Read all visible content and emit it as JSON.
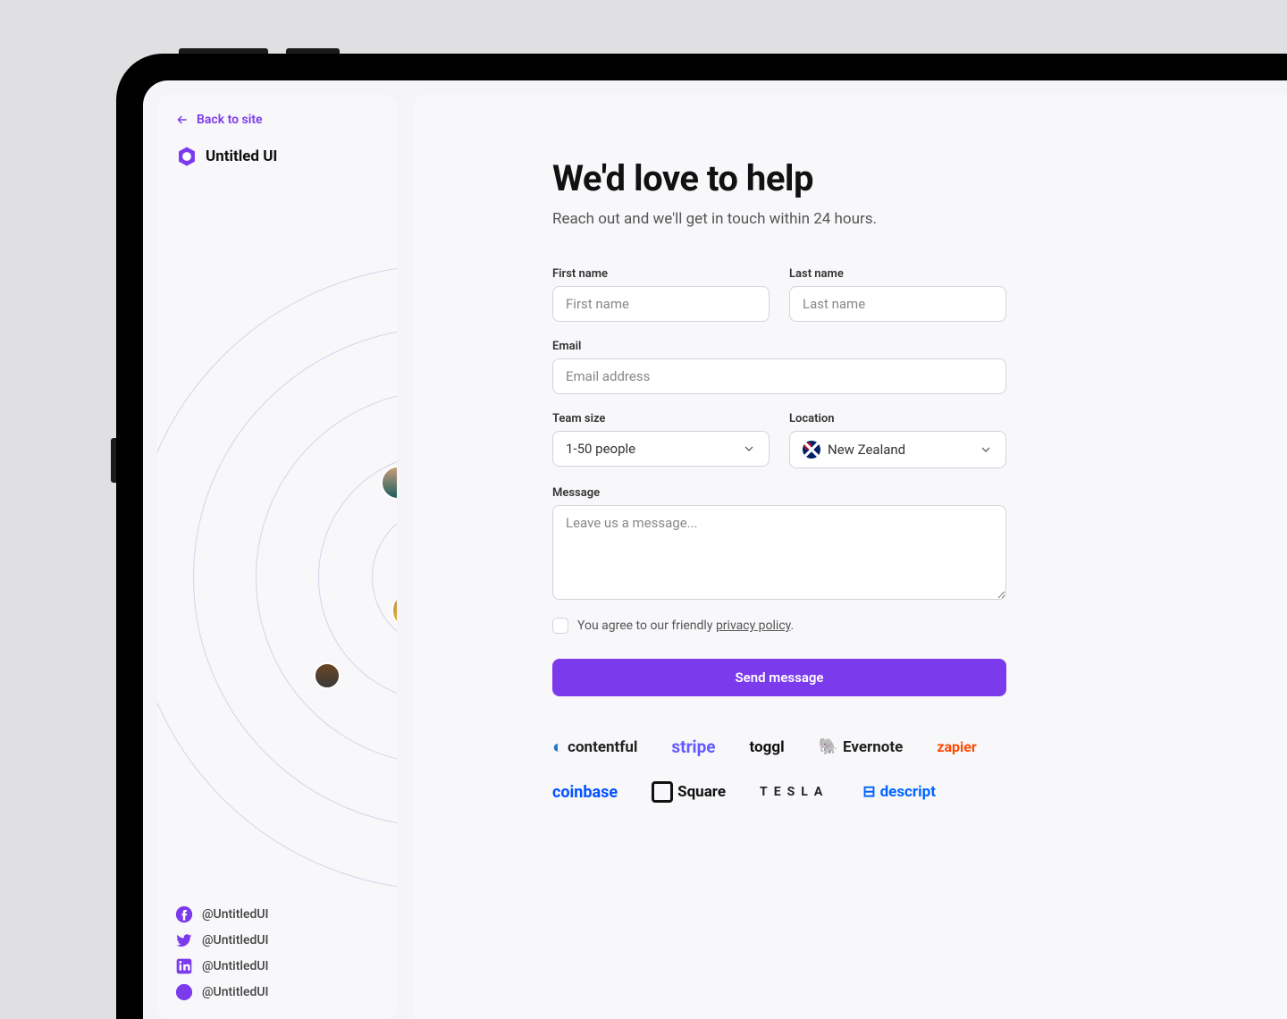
{
  "sidebar": {
    "back_label": "Back to site",
    "brand_name": "Untitled UI",
    "socials": {
      "facebook": "@UntitledUI",
      "twitter": "@UntitledUI",
      "linkedin": "@UntitledUI",
      "dribbble": "@UntitledUI"
    }
  },
  "main": {
    "title": "We'd love to help",
    "subtitle": "Reach out and we'll get in touch within 24 hours.",
    "fields": {
      "first_name_label": "First name",
      "first_name_placeholder": "First name",
      "last_name_label": "Last name",
      "last_name_placeholder": "Last name",
      "email_label": "Email",
      "email_placeholder": "Email address",
      "team_size_label": "Team size",
      "team_size_value": "1-50 people",
      "location_label": "Location",
      "location_value": "New Zealand",
      "message_label": "Message",
      "message_placeholder": "Leave us a message..."
    },
    "policy_prefix": "You agree to our friendly ",
    "policy_link": "privacy policy",
    "policy_suffix": ".",
    "submit_label": "Send message"
  },
  "logos": {
    "contentful": "contentful",
    "stripe": "stripe",
    "toggl": "toggl",
    "evernote": "Evernote",
    "zapier": "zapier",
    "coinbase": "coinbase",
    "square": "Square",
    "tesla": "TESLA",
    "descript": "descript"
  },
  "colors": {
    "accent": "#7c3aed",
    "background": "#f8f7fa"
  }
}
